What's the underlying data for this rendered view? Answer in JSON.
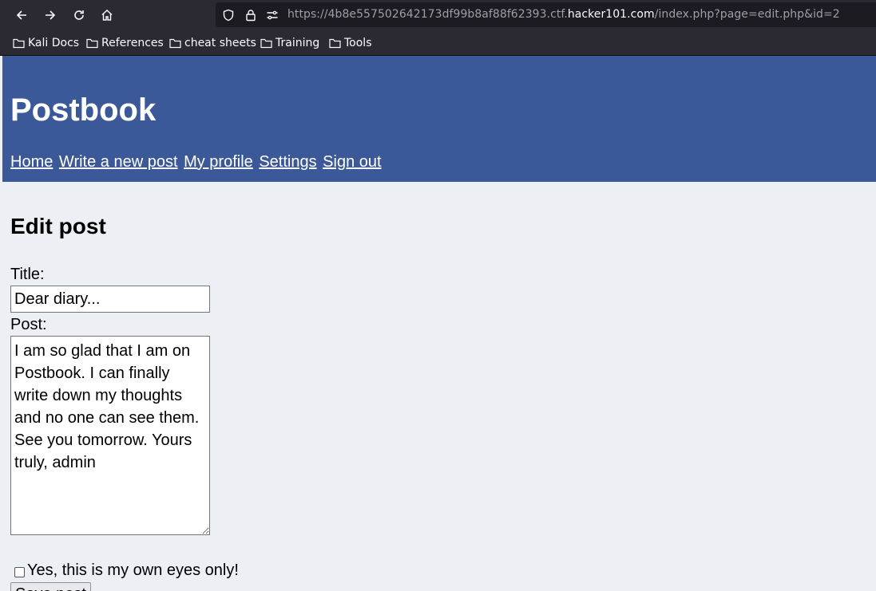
{
  "browser": {
    "url_prefix": "https://4b8e557502642173df99b8af88f62393.ctf.",
    "url_host": "hacker101.com",
    "url_path": "/index.php?page=edit.php&id=2",
    "bookmarks": [
      {
        "label": "Kali Docs"
      },
      {
        "label": "References"
      },
      {
        "label": "cheat sheets"
      },
      {
        "label": "Training"
      },
      {
        "label": "Tools"
      }
    ]
  },
  "site": {
    "title": "Postbook",
    "nav": [
      {
        "label": "Home"
      },
      {
        "label": "Write a new post"
      },
      {
        "label": "My profile"
      },
      {
        "label": "Settings"
      },
      {
        "label": "Sign out"
      }
    ]
  },
  "form": {
    "heading": "Edit post",
    "title_label": "Title:",
    "title_value": "Dear diary...",
    "post_label": "Post:",
    "post_value": "I am so glad that I am on Postbook. I can finally write down my thoughts and no one can see them. See you tomorrow. Yours truly, admin",
    "private_label": "Yes, this is my own eyes only!",
    "private_checked": false,
    "submit_label": "Save post"
  }
}
